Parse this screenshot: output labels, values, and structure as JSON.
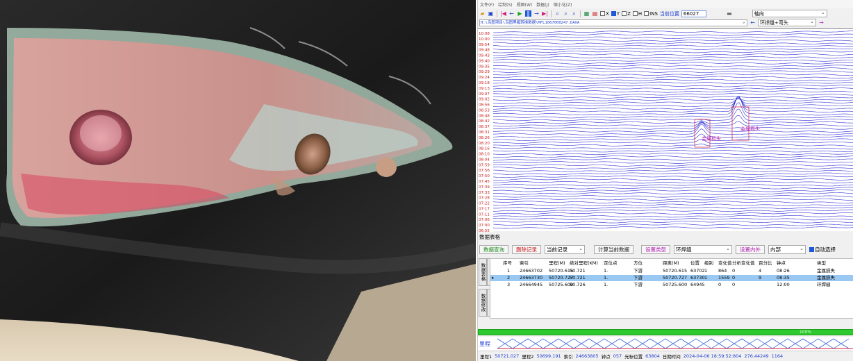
{
  "menu": [
    "文件(F)",
    "绘制(S)",
    "视图(W)",
    "数据(J)",
    "缩小化(Z)"
  ],
  "toolbar": {
    "checks": [
      {
        "label": "X",
        "checked": false
      },
      {
        "label": "Y",
        "checked": true
      },
      {
        "label": "Z",
        "checked": false
      },
      {
        "label": "H",
        "checked": false
      },
      {
        "label": "INS",
        "checked": false
      }
    ],
    "current_pos_label": "当前位置",
    "current_pos_value": "66027",
    "axis_select": "轴向",
    "path": "H:\\鸟图项目\\鸟图黑箱转换数据\\MFL1067000247.DAXA",
    "weld_select": "环焊缝+弯头"
  },
  "plot": {
    "time_labels": [
      "10:08",
      "10:00",
      "09:54",
      "09:48",
      "09:43",
      "09:40",
      "09:35",
      "09:29",
      "09:24",
      "09:18",
      "09:13",
      "09:07",
      "09:02",
      "08:56",
      "08:53",
      "08:48",
      "08:42",
      "08:37",
      "08:31",
      "08:26",
      "08:20",
      "08:16",
      "08:10",
      "08:04",
      "07:59",
      "07:56",
      "07:50",
      "07:45",
      "07:39",
      "07:33",
      "07:28",
      "07:22",
      "07:17",
      "07:11",
      "07:06",
      "07:00",
      "06:55"
    ],
    "annotations": [
      "金属损失",
      "金属损失"
    ],
    "line_color": "#2f2fd6"
  },
  "section_title": "数据表格",
  "buttons": {
    "query": "数据查询",
    "delete": "删除记录",
    "current_record": "当前记录",
    "calc": "计算当前数据",
    "set_type": "设置类型",
    "type_value": "环焊缝",
    "set_inout": "设置内外",
    "inout_value": "内部",
    "auto_select": "自动选择"
  },
  "vertical_tabs": [
    "数据表格",
    "条件选择",
    "数据修改",
    "清除页面"
  ],
  "table": {
    "headers": [
      "序号",
      "索引",
      "里程(M)",
      "绝对里程(KM)",
      "定位点",
      "方位",
      "距离(M)",
      "位置",
      "级别",
      "变化值",
      "分析变化值",
      "百分比",
      "钟点",
      "类型"
    ],
    "rows": [
      [
        "1",
        "24663702",
        "50720.615",
        "50.721",
        "1.",
        "下游",
        "50720.615",
        "63702",
        "1",
        "864",
        "0",
        "4",
        "08:26",
        "金属损失"
      ],
      [
        "2",
        "24663730",
        "50720.727",
        "50.721",
        "1.",
        "下游",
        "50720.727",
        "63730",
        "1",
        "1559",
        "0",
        "9",
        "08:35",
        "金属损失"
      ],
      [
        "3",
        "24664945",
        "50725.600",
        "50.726",
        "1.",
        "下游",
        "50725.600",
        "64945",
        "",
        "0",
        "0",
        "",
        "12:00",
        "环焊缝"
      ]
    ],
    "selected_index": 1
  },
  "progress_label": "100%",
  "mileage_label": "里程",
  "status": {
    "mileage1_label": "里程1",
    "mileage1": "50721.027",
    "mileage2_label": "里程2",
    "mileage2": "50699.191",
    "index_label": "索引",
    "index": "24663805",
    "clock_label": "钟点",
    "clock": "057",
    "cursor_label": "光标位置",
    "cursor": "63804",
    "date_label": "日期时间",
    "date": "2024-04-06 18:59:52:804",
    "v1": "276.44249",
    "v2": "1164"
  }
}
